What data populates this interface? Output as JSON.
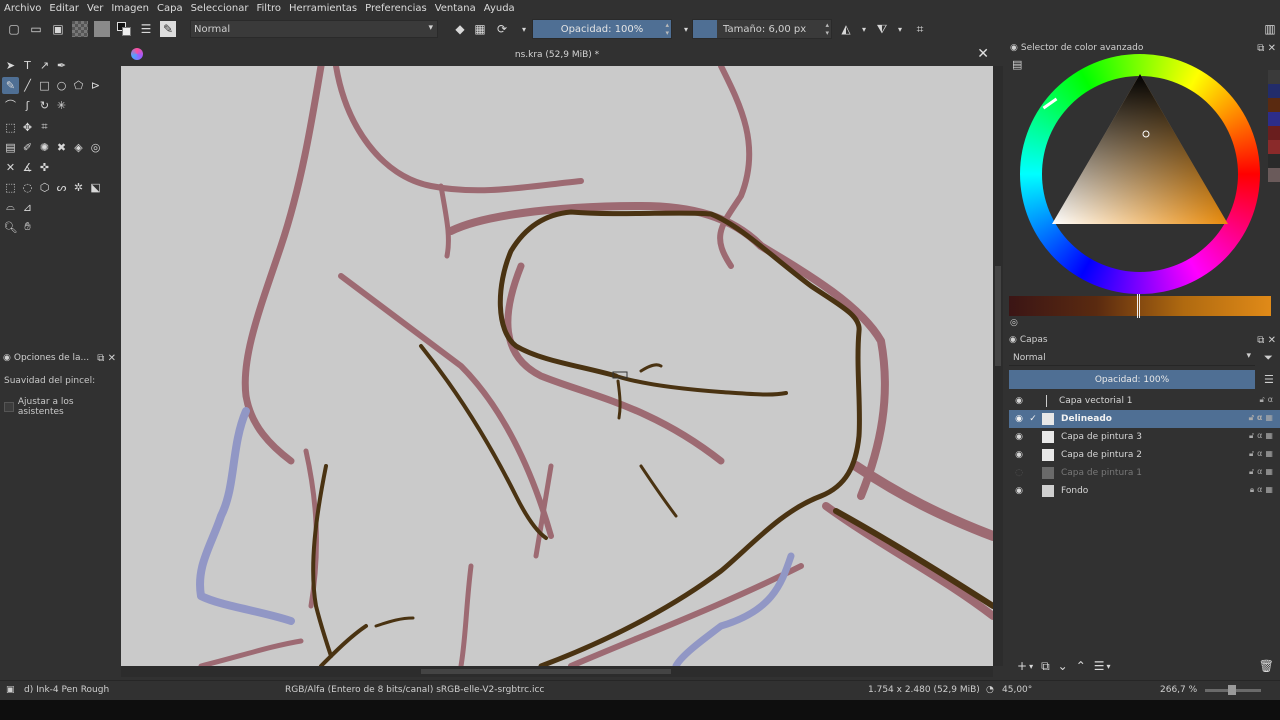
{
  "menu": [
    "Archivo",
    "Editar",
    "Ver",
    "Imagen",
    "Capa",
    "Seleccionar",
    "Filtro",
    "Herramientas",
    "Preferencias",
    "Ventana",
    "Ayuda"
  ],
  "toolbar": {
    "blend_mode": "Normal",
    "opacity_label": "Opacidad: 100%",
    "size_label": "Tamaño: 6,00 px"
  },
  "document": {
    "title": "ns.kra (52,9 MiB) *"
  },
  "tool_options": {
    "title": "Opciones de la...",
    "smoothing_label": "Suavidad del pincel:",
    "assist_label": "Ajustar a los asistentes"
  },
  "color_selector": {
    "title": "Selector de color avanzado",
    "current_color": "#d98a1c"
  },
  "layers": {
    "title": "Capas",
    "blend_mode": "Normal",
    "opacity_label": "Opacidad:  100%",
    "items": [
      {
        "name": "Capa vectorial 1",
        "state": "visible"
      },
      {
        "name": "Delineado",
        "state": "selected"
      },
      {
        "name": "Capa de pintura 3",
        "state": "visible"
      },
      {
        "name": "Capa de pintura 2",
        "state": "visible"
      },
      {
        "name": "Capa de pintura 1",
        "state": "hidden"
      },
      {
        "name": "Fondo",
        "state": "locked"
      }
    ]
  },
  "status": {
    "brush": "d) Ink-4 Pen Rough",
    "color_info": "RGB/Alfa (Entero de 8 bits/canal)  sRGB-elle-V2-srgbtrc.icc",
    "dimensions": "1.754 x 2.480 (52,9 MiB)",
    "rotation": "45,00°",
    "zoom": "266,7 %"
  },
  "colors": {
    "accent": "#4f6f94",
    "canvas_bg": "#cacaca",
    "sketch_red": "#8e4a55",
    "sketch_blue": "#7f86c4",
    "ink": "#4a3312"
  }
}
